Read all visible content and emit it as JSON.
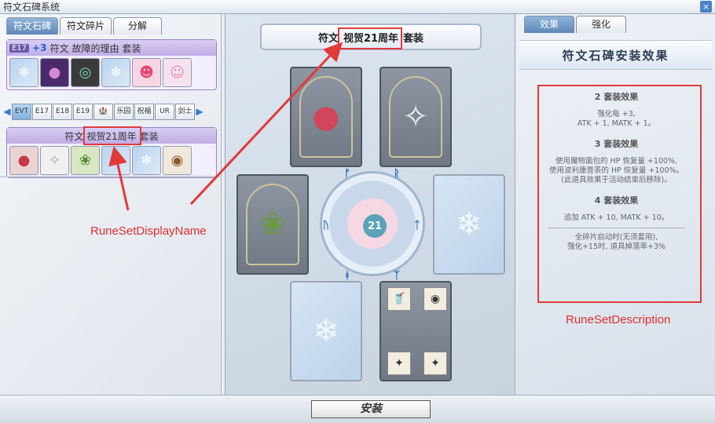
{
  "window": {
    "title": "符文石碑系统",
    "close_glyph": "×"
  },
  "left_panel": {
    "tabs": [
      {
        "label": "符文石碑",
        "active": true
      },
      {
        "label": "符文碎片",
        "active": false
      },
      {
        "label": "分解",
        "active": false
      }
    ],
    "selected_set": {
      "badge": "E17",
      "enhance": "+3",
      "prefix": "符文",
      "name": "故障的理由",
      "suffix": "套装",
      "icons": [
        "snow-icon",
        "purple-creature-icon",
        "machine-icon",
        "snow-icon",
        "pink-doll-icon",
        "pink-girl-icon"
      ]
    },
    "filters": [
      {
        "label": "EVT",
        "active": true
      },
      {
        "label": "E17",
        "active": false
      },
      {
        "label": "E18",
        "active": false
      },
      {
        "label": "E19",
        "active": false
      },
      {
        "label": "🏰",
        "active": false
      },
      {
        "label": "乐园",
        "active": false
      },
      {
        "label": "祝福",
        "active": false
      },
      {
        "label": "UR",
        "active": false
      },
      {
        "label": "剑士",
        "active": false
      }
    ],
    "list_set": {
      "prefix": "符文",
      "name": "视贺21周年",
      "suffix": "套装",
      "icons": [
        "poring-icon",
        "rabbit-icon",
        "green-slime-icon",
        "snow-icon",
        "snow-icon",
        "cake-icon"
      ]
    }
  },
  "center_panel": {
    "banner": {
      "prefix": "符文",
      "name": "视贺21周年",
      "suffix": "套装"
    },
    "wheel_number": "21",
    "install_label": "安装"
  },
  "right_panel": {
    "tabs": [
      {
        "label": "效果",
        "active": true
      },
      {
        "label": "强化",
        "active": false
      }
    ],
    "header": "符文石碑安装效果",
    "effects": {
      "set2_title": "2 套装效果",
      "set2_line1": "强化每 +3,",
      "set2_line2": "ATK + 1, MATK + 1。",
      "set3_title": "3 套装效果",
      "set3_line1": "使用魔物面包的 HP 恢复量 +100%,",
      "set3_line2": "使用波利康普茶的 HP 恢复量 +100%。",
      "set3_line3": "(此道具效果于活动结束后移除)。",
      "set4_title": "4 套装效果",
      "set4_line1": "追加 ATK + 10, MATK + 10。",
      "set4_line2": "全碎片启动时(无须套用),",
      "set4_line3": "强化+15时, 道具掉落率+3%"
    }
  },
  "annotations": {
    "display_name_label": "RuneSetDisplayName",
    "description_label": "RuneSetDescription"
  }
}
